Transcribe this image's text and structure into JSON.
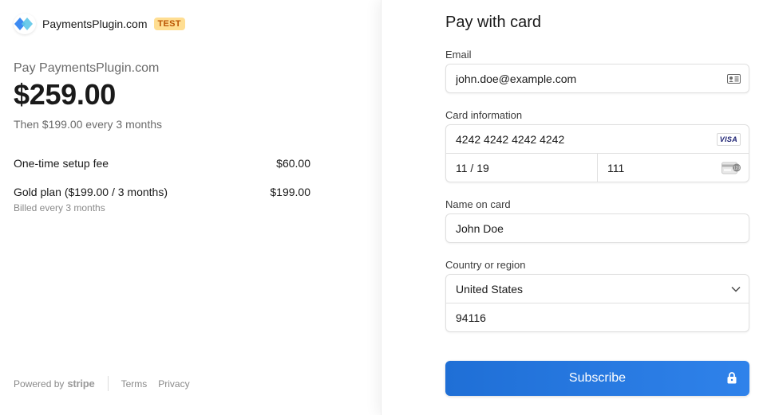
{
  "merchant": {
    "name": "PaymentsPlugin.com",
    "test_badge": "TEST"
  },
  "summary": {
    "pay_label": "Pay PaymentsPlugin.com",
    "amount": "$259.00",
    "then_text": "Then $199.00 every 3 months",
    "line_items": [
      {
        "name": "One-time setup fee",
        "price": "$60.00",
        "sub": ""
      },
      {
        "name": "Gold plan ($199.00 / 3 months)",
        "price": "$199.00",
        "sub": "Billed every 3 months"
      }
    ]
  },
  "footer": {
    "powered_by": "Powered by",
    "stripe": "stripe",
    "terms": "Terms",
    "privacy": "Privacy"
  },
  "form": {
    "title": "Pay with card",
    "email_label": "Email",
    "email_value": "john.doe@example.com",
    "card_label": "Card information",
    "card_number": "4242 4242 4242 4242",
    "card_brand": "VISA",
    "expiry": "11 / 19",
    "cvc": "111",
    "name_label": "Name on card",
    "name_value": "John Doe",
    "country_label": "Country or region",
    "country_value": "United States",
    "zip_value": "94116",
    "submit_label": "Subscribe"
  },
  "colors": {
    "accent": "#1f6fd6",
    "test_badge_bg": "#ffde92",
    "test_badge_fg": "#bb5504",
    "visa_blue": "#1a1f71"
  },
  "icons": {
    "brand_logo": "payments-plugin-logo",
    "email_card": "contact-card-icon",
    "card_brand": "visa-icon",
    "cvc": "cvc-card-icon",
    "select": "chevron-down-icon",
    "submit": "lock-icon"
  }
}
